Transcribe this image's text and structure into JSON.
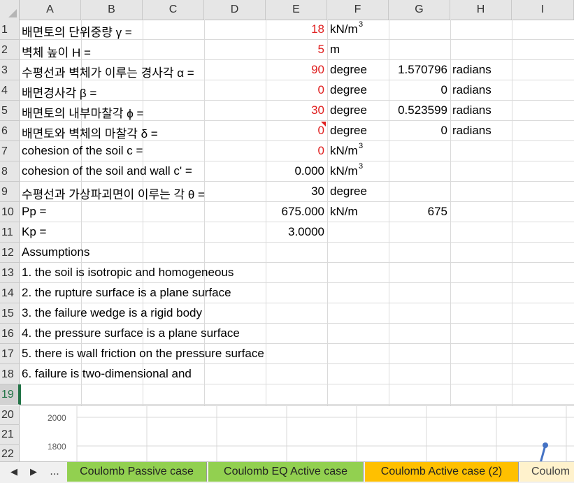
{
  "columns": [
    "A",
    "B",
    "C",
    "D",
    "E",
    "F",
    "G",
    "H",
    "I"
  ],
  "rows": [
    {
      "num": "1",
      "a": "배면토의 단위중량 γ =",
      "e": "18",
      "e_red": true,
      "f": "kN/m",
      "f_sup": "3",
      "g": "",
      "h": ""
    },
    {
      "num": "2",
      "a": "벽체 높이 H =",
      "e": "5",
      "e_red": true,
      "f": "m",
      "f_sup": "",
      "g": "",
      "h": ""
    },
    {
      "num": "3",
      "a": "수평선과 벽체가 이루는 경사각 α =",
      "e": "90",
      "e_red": true,
      "f": "degree",
      "f_sup": "",
      "g": "1.570796",
      "h": "radians"
    },
    {
      "num": "4",
      "a": "배면경사각 β =",
      "e": "0",
      "e_red": true,
      "f": "degree",
      "f_sup": "",
      "g": "0",
      "h": "radians"
    },
    {
      "num": "5",
      "a": "배면토의 내부마찰각 ϕ =",
      "e": "30",
      "e_red": true,
      "f": "degree",
      "f_sup": "",
      "g": "0.523599",
      "h": "radians"
    },
    {
      "num": "6",
      "a": "배면토와 벽체의 마찰각 δ =",
      "e": "0",
      "e_red": true,
      "f": "degree",
      "f_sup": "",
      "g": "0",
      "h": "radians"
    },
    {
      "num": "7",
      "a": "cohesion of the soil c =",
      "e": "0",
      "e_red": true,
      "f": "kN/m",
      "f_sup": "3",
      "g": "",
      "h": ""
    },
    {
      "num": "8",
      "a": "cohesion of the soil and wall c' =",
      "e": "0.000",
      "e_red": false,
      "f": "kN/m",
      "f_sup": "3",
      "g": "",
      "h": ""
    },
    {
      "num": "9",
      "a": "수평선과 가상파괴면이 이루는 각 θ =",
      "e": "30",
      "e_red": false,
      "f": "degree",
      "f_sup": "",
      "g": "",
      "h": ""
    },
    {
      "num": "10",
      "a": "Pp =",
      "e": "675.000",
      "e_red": false,
      "f": "kN/m",
      "f_sup": "",
      "g": "675",
      "h": ""
    },
    {
      "num": "11",
      "a": "Kp =",
      "e": "3.0000",
      "e_red": false,
      "f": "",
      "f_sup": "",
      "g": "",
      "h": ""
    },
    {
      "num": "12",
      "a": "Assumptions",
      "e": "",
      "e_red": false,
      "f": "",
      "f_sup": "",
      "g": "",
      "h": ""
    },
    {
      "num": "13",
      "a": "1. the soil is isotropic and homogeneous",
      "e": "",
      "e_red": false,
      "f": "",
      "f_sup": "",
      "g": "",
      "h": ""
    },
    {
      "num": "14",
      "a": "2. the rupture surface is a plane surface",
      "e": "",
      "e_red": false,
      "f": "",
      "f_sup": "",
      "g": "",
      "h": ""
    },
    {
      "num": "15",
      "a": "3. the failure wedge is a rigid body",
      "e": "",
      "e_red": false,
      "f": "",
      "f_sup": "",
      "g": "",
      "h": ""
    },
    {
      "num": "16",
      "a": "4. the pressure surface is a plane surface",
      "e": "",
      "e_red": false,
      "f": "",
      "f_sup": "",
      "g": "",
      "h": ""
    },
    {
      "num": "17",
      "a": "5. there is wall friction on the pressure surface",
      "e": "",
      "e_red": false,
      "f": "",
      "f_sup": "",
      "g": "",
      "h": ""
    },
    {
      "num": "18",
      "a": "6. failure is two-dimensional and",
      "e": "",
      "e_red": false,
      "f": "",
      "f_sup": "",
      "g": "",
      "h": ""
    },
    {
      "num": "19",
      "a": "",
      "e": "",
      "e_red": false,
      "f": "",
      "f_sup": "",
      "g": "",
      "h": ""
    }
  ],
  "lower_rows": [
    "20",
    "21",
    "22"
  ],
  "chart": {
    "y_ticks": [
      "2000",
      "1800"
    ],
    "line_color": "#4472c4"
  },
  "tabs": {
    "nav_prev": "◀",
    "nav_next": "▶",
    "nav_more": "...",
    "items": [
      {
        "label": "Coulomb Passive case",
        "color": "#92d050"
      },
      {
        "label": "Coulomb EQ Active case",
        "color": "#92d050"
      },
      {
        "label": "Coulomb Active case (2)",
        "color": "#ffc000"
      },
      {
        "label": "Coulom",
        "color": "#fff2cc"
      }
    ]
  }
}
